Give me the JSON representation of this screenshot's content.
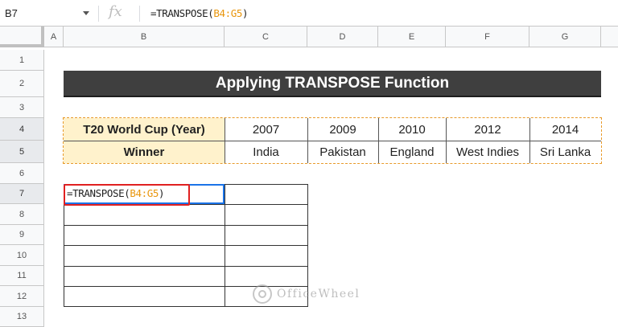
{
  "formula_bar": {
    "name_box": "B7",
    "fx_label": "fx",
    "formula_prefix": "=TRANSPOSE(",
    "formula_ref": "B4:G5",
    "formula_suffix": ")"
  },
  "columns": [
    "A",
    "B",
    "C",
    "D",
    "E",
    "F",
    "G"
  ],
  "rows": [
    "1",
    "2",
    "3",
    "4",
    "5",
    "6",
    "7",
    "8",
    "9",
    "10",
    "11",
    "12",
    "13"
  ],
  "sheet": {
    "title": "Applying TRANSPOSE Function",
    "table": {
      "header_row": [
        "T20 World Cup (Year)",
        "2007",
        "2009",
        "2010",
        "2012",
        "2014"
      ],
      "winner_row": [
        "Winner",
        "India",
        "Pakistan",
        "England",
        "West Indies",
        "Sri Lanka"
      ]
    },
    "editing_cell": {
      "prefix": "=TRANSPOSE(",
      "ref": "B4:G5",
      "suffix": ")"
    }
  },
  "watermark": "OfficeWheel",
  "colors": {
    "title_bg": "#3f3f3f",
    "header_fill": "#fff2cc",
    "range_highlight": "#e89a2a",
    "active_cell": "#1a73e8",
    "callout": "#e02020"
  }
}
